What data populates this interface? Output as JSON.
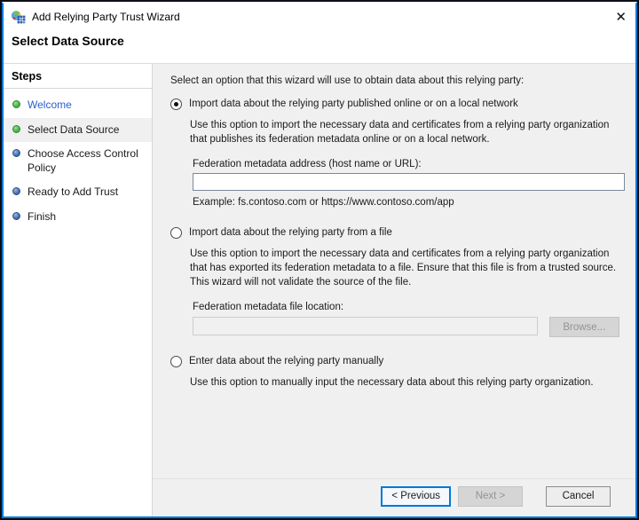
{
  "window": {
    "title": "Add Relying Party Trust Wizard"
  },
  "icons": {
    "close": "✕",
    "app": "relying-party-trust-icon"
  },
  "header": {
    "title": "Select Data Source"
  },
  "sidebar": {
    "heading": "Steps",
    "items": [
      {
        "label": "Welcome",
        "bullet": "done",
        "visited": true,
        "current": false
      },
      {
        "label": "Select Data Source",
        "bullet": "done",
        "visited": false,
        "current": true
      },
      {
        "label": "Choose Access Control Policy",
        "bullet": "todo",
        "visited": false,
        "current": false
      },
      {
        "label": "Ready to Add Trust",
        "bullet": "todo",
        "visited": false,
        "current": false
      },
      {
        "label": "Finish",
        "bullet": "todo",
        "visited": false,
        "current": false
      }
    ]
  },
  "content": {
    "intro": "Select an option that this wizard will use to obtain data about this relying party:",
    "options": [
      {
        "label": "Import data about the relying party published online or on a local network",
        "selected": true,
        "description": "Use this option to import the necessary data and certificates from a relying party organization that publishes its federation metadata online or on a local network.",
        "field_label": "Federation metadata address (host name or URL):",
        "field_value": "",
        "example": "Example: fs.contoso.com or https://www.contoso.com/app"
      },
      {
        "label": "Import data about the relying party from a file",
        "selected": false,
        "description": "Use this option to import the necessary data and certificates from a relying party organization that has exported its federation metadata to a file. Ensure that this file is from a trusted source.  This wizard will not validate the source of the file.",
        "field_label": "Federation metadata file location:",
        "field_value": "",
        "browse_label": "Browse..."
      },
      {
        "label": "Enter data about the relying party manually",
        "selected": false,
        "description": "Use this option to manually input the necessary data about this relying party organization."
      }
    ]
  },
  "footer": {
    "previous_label": "< Previous",
    "next_label": "Next >",
    "cancel_label": "Cancel"
  },
  "colors": {
    "accent_border": "#0078d7",
    "visited_step_link": "#2b5fcc",
    "done_bullet": "#3fae49",
    "todo_bullet": "#3a67a8",
    "content_background": "#f0f0f0",
    "disabled_text": "#939393"
  }
}
